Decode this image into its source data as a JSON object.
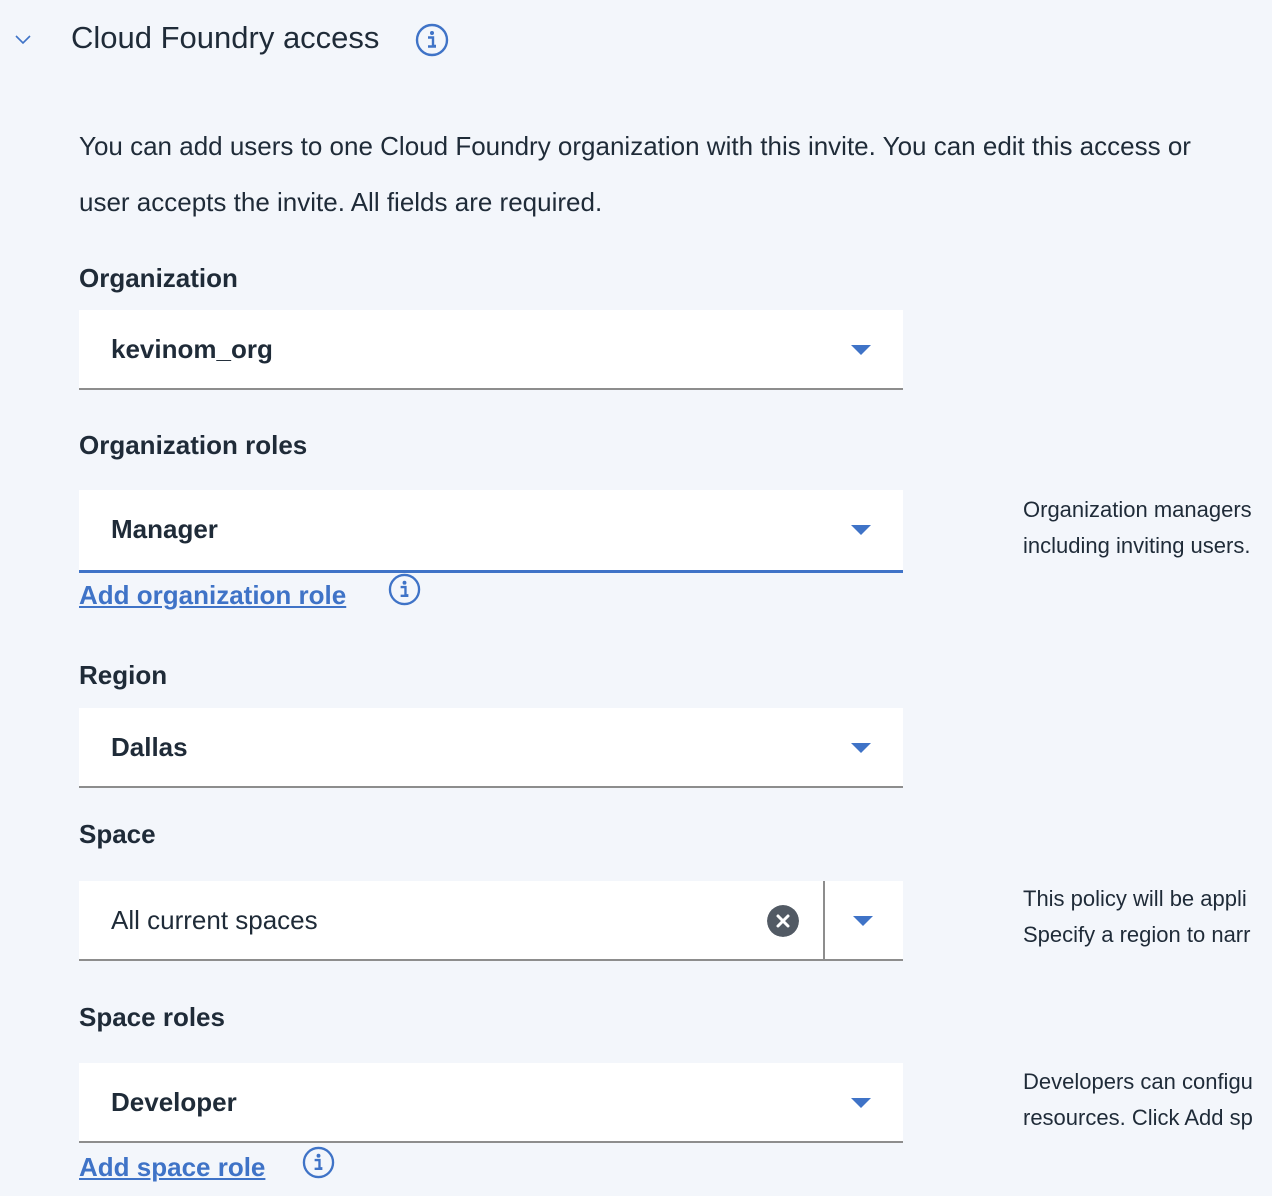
{
  "section": {
    "title": "Cloud Foundry access",
    "description_line1": "You can add users to one Cloud Foundry organization with this invite. You can edit this access or",
    "description_line2": "user accepts the invite. All fields are required."
  },
  "organization": {
    "label": "Organization",
    "value": "kevinom_org"
  },
  "organization_roles": {
    "label": "Organization roles",
    "value": "Manager",
    "add_link": "Add organization role",
    "help_line1": "Organization managers",
    "help_line2": "including inviting users."
  },
  "region": {
    "label": "Region",
    "value": "Dallas"
  },
  "space": {
    "label": "Space",
    "value": "All current spaces",
    "help_line1": "This policy will be appli",
    "help_line2": "Specify a region to narr"
  },
  "space_roles": {
    "label": "Space roles",
    "value": "Developer",
    "add_link": "Add space role",
    "help_line1": "Developers can configu",
    "help_line2": "resources. Click Add sp"
  },
  "icons": {
    "collapse": "chevron-down-icon",
    "info": "info-icon",
    "clear": "clear-icon",
    "dropdown": "caret-down-icon"
  },
  "colors": {
    "accent": "#3f73c7",
    "background": "#f3f6fb",
    "text": "#1f2b38"
  }
}
